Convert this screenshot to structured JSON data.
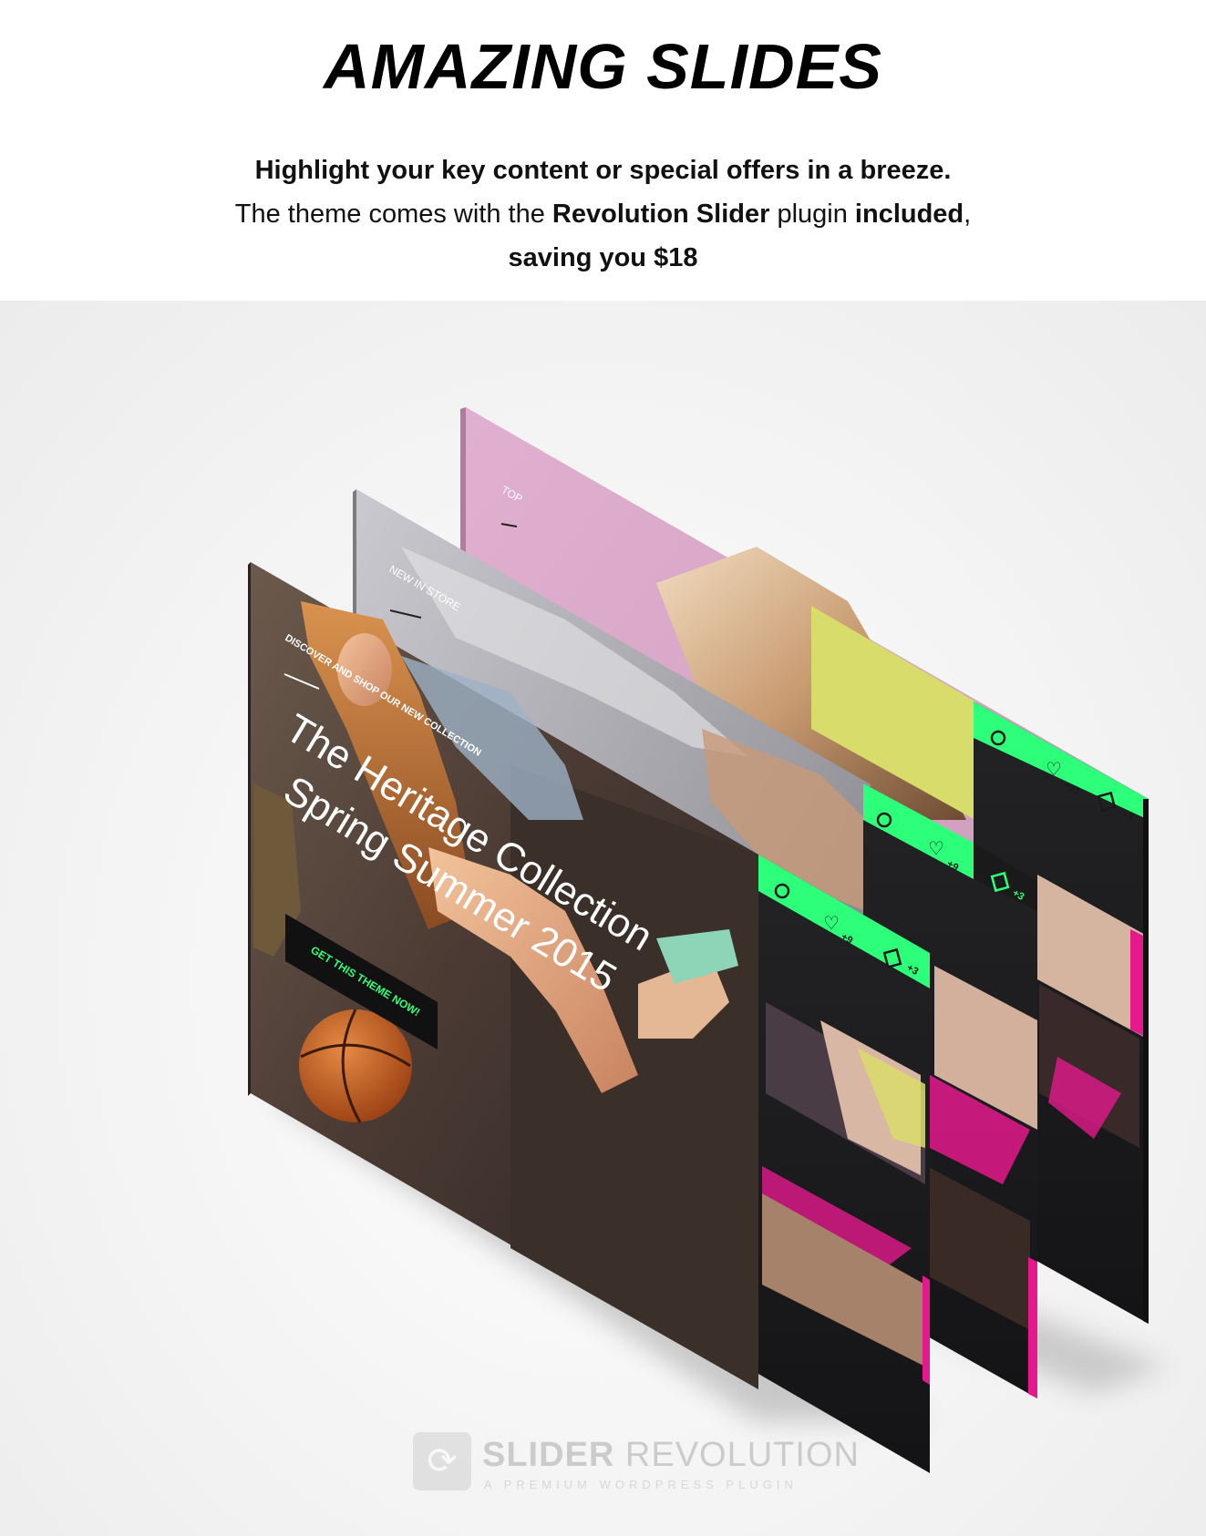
{
  "header": {
    "title": "AMAZING SLIDES",
    "line1": "Highlight your key content or special offers in a breeze.",
    "line2_prefix": "The theme comes with the ",
    "line2_bold1": "Revolution Slider",
    "line2_mid": " plugin ",
    "line2_bold2": "included",
    "line2_suffix": ",",
    "line3": "saving you $18"
  },
  "slides": {
    "back_label": "TOP",
    "mid_label": "NEW IN STORE",
    "front_kicker": "DISCOVER AND SHOP OUR NEW COLLECTION",
    "front_headline_1": "The Heritage Collection",
    "front_headline_2": "Spring Summer 2015",
    "front_cta": "GET THIS THEME NOW!"
  },
  "mobile": {
    "card1": {
      "likes": "+9",
      "cart": "+3"
    },
    "card2": {
      "likes": "+9",
      "cart": "+3"
    },
    "card3": {
      "likes": "+21",
      "cart": "+5"
    }
  },
  "logo": {
    "brand_bold": "SLIDER",
    "brand_light": " REVOLUTION",
    "tagline": "A PREMIUM WORDPRESS PLUGIN"
  },
  "colors": {
    "accent_green": "#2dff7a",
    "accent_pink": "#e3198c",
    "pink_slide": "#d9a3c6",
    "yellow_panel": "#d8dc6a"
  }
}
